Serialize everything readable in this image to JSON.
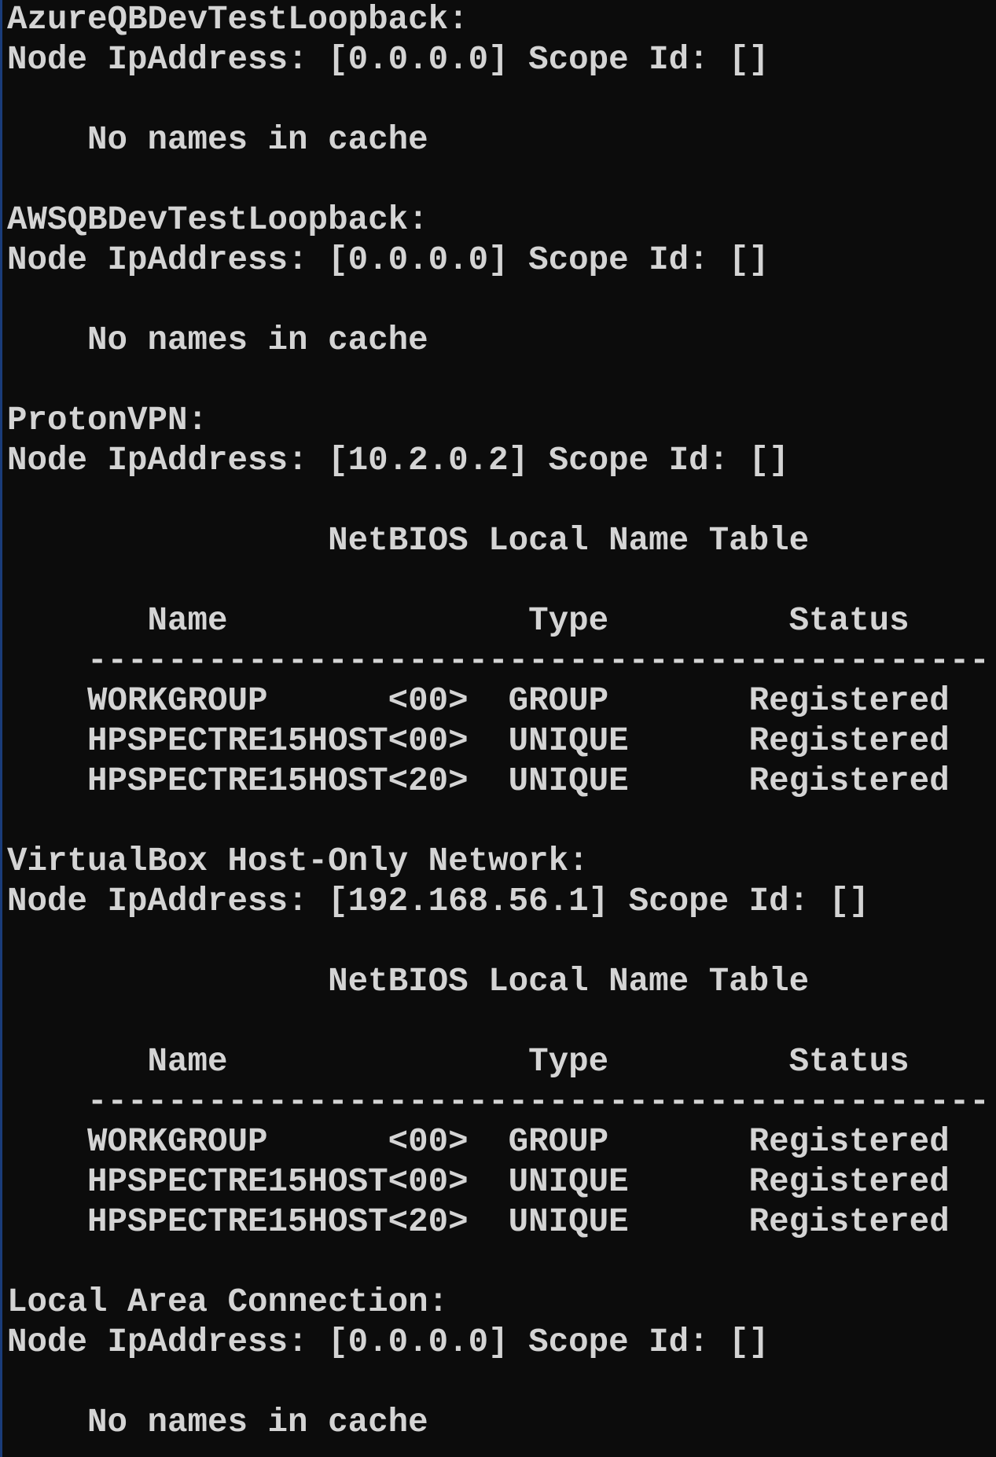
{
  "terminal": {
    "lines": [
      "AzureQBDevTestLoopback:",
      "Node IpAddress: [0.0.0.0] Scope Id: []",
      "",
      "    No names in cache",
      "",
      "AWSQBDevTestLoopback:",
      "Node IpAddress: [0.0.0.0] Scope Id: []",
      "",
      "    No names in cache",
      "",
      "ProtonVPN:",
      "Node IpAddress: [10.2.0.2] Scope Id: []",
      "",
      "                NetBIOS Local Name Table",
      "",
      "       Name               Type         Status",
      "    ---------------------------------------------",
      "    WORKGROUP      <00>  GROUP       Registered",
      "    HPSPECTRE15HOST<00>  UNIQUE      Registered",
      "    HPSPECTRE15HOST<20>  UNIQUE      Registered",
      "",
      "VirtualBox Host-Only Network:",
      "Node IpAddress: [192.168.56.1] Scope Id: []",
      "",
      "                NetBIOS Local Name Table",
      "",
      "       Name               Type         Status",
      "    ---------------------------------------------",
      "    WORKGROUP      <00>  GROUP       Registered",
      "    HPSPECTRE15HOST<00>  UNIQUE      Registered",
      "    HPSPECTRE15HOST<20>  UNIQUE      Registered",
      "",
      "Local Area Connection:",
      "Node IpAddress: [0.0.0.0] Scope Id: []",
      "",
      "    No names in cache"
    ]
  },
  "colors": {
    "background": "#0c0c0c",
    "foreground": "#d4d4d4",
    "left_edge": "#1a3c7a"
  }
}
